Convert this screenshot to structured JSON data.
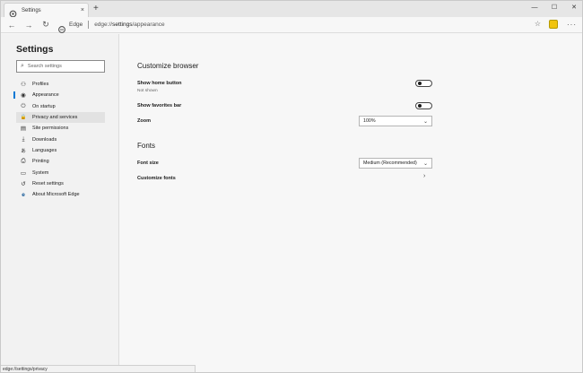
{
  "tab": {
    "title": "Settings",
    "close": "×",
    "new_tab": "+"
  },
  "window_controls": {
    "minimize": "—",
    "maximize": "☐",
    "close": "✕"
  },
  "toolbar": {
    "back": "←",
    "forward": "→",
    "refresh": "↻",
    "brand": "Edge",
    "url_prefix": "edge://",
    "url_bold": "settings",
    "url_suffix": "/appearance",
    "star": "☆",
    "more": "···"
  },
  "sidebar": {
    "title": "Settings",
    "search_placeholder": "Search settings",
    "items": [
      {
        "label": "Profiles",
        "icon": "person-icon",
        "glyph": "⚇"
      },
      {
        "label": "Appearance",
        "icon": "palette-icon",
        "glyph": "◉"
      },
      {
        "label": "On startup",
        "icon": "power-icon",
        "glyph": "⏻"
      },
      {
        "label": "Privacy and services",
        "icon": "lock-icon",
        "glyph": "🔒"
      },
      {
        "label": "Site permissions",
        "icon": "permissions-icon",
        "glyph": "▤"
      },
      {
        "label": "Downloads",
        "icon": "download-icon",
        "glyph": "⤓"
      },
      {
        "label": "Languages",
        "icon": "languages-icon",
        "glyph": "あ"
      },
      {
        "label": "Printing",
        "icon": "printer-icon",
        "glyph": "⎙"
      },
      {
        "label": "System",
        "icon": "system-icon",
        "glyph": "▭"
      },
      {
        "label": "Reset settings",
        "icon": "reset-icon",
        "glyph": "↺"
      },
      {
        "label": "About Microsoft Edge",
        "icon": "edge-logo-icon",
        "glyph": "e"
      }
    ]
  },
  "main": {
    "customize_title": "Customize browser",
    "show_home_label": "Show home button",
    "show_home_sub": "Not shown",
    "show_favorites_label": "Show favorites bar",
    "zoom_label": "Zoom",
    "zoom_value": "100%",
    "fonts_title": "Fonts",
    "font_size_label": "Font size",
    "font_size_value": "Medium (Recommended)",
    "customize_fonts_label": "Customize fonts",
    "chevron_down": "⌄",
    "chevron_right": "›"
  },
  "status": {
    "url": "edge://settings/privacy"
  },
  "colors": {
    "accent": "#0078d4",
    "sidebar_bg": "#f2f2f2",
    "main_bg": "#f7f7f7"
  }
}
